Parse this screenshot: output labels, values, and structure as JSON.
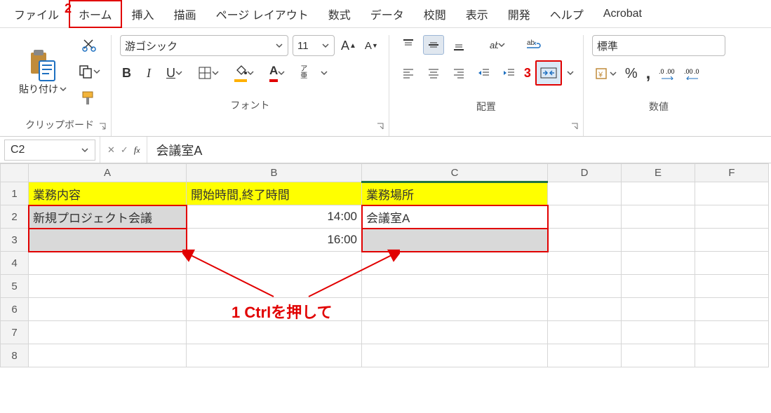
{
  "menu": {
    "file": "ファイル",
    "home": "ホーム",
    "insert": "挿入",
    "draw": "描画",
    "layout": "ページ レイアウト",
    "formula": "数式",
    "data": "データ",
    "review": "校閲",
    "view": "表示",
    "dev": "開発",
    "help": "ヘルプ",
    "acrobat": "Acrobat",
    "home_num": "2"
  },
  "clipboard": {
    "paste": "貼り付け",
    "group": "クリップボード"
  },
  "font": {
    "name": "游ゴシック",
    "size": "11",
    "bold": "B",
    "italic": "I",
    "under": "U",
    "ruby": "ア\n亜",
    "group": "フォント"
  },
  "align": {
    "group": "配置",
    "merge_num": "3"
  },
  "number": {
    "format": "標準",
    "group": "数値"
  },
  "namebox": "C2",
  "formula": "会議室A",
  "columns": [
    "A",
    "B",
    "C",
    "D",
    "E",
    "F"
  ],
  "rows": [
    "1",
    "2",
    "3",
    "4",
    "5",
    "6",
    "7",
    "8"
  ],
  "cells": {
    "A1": "業務内容",
    "B1": "開始時間,終了時間",
    "C1": "業務場所",
    "A2": "新規プロジェクト会議",
    "B2": "14:00",
    "C2": "会議室A",
    "B3": "16:00"
  },
  "annotation": "1 Ctrlを押して"
}
